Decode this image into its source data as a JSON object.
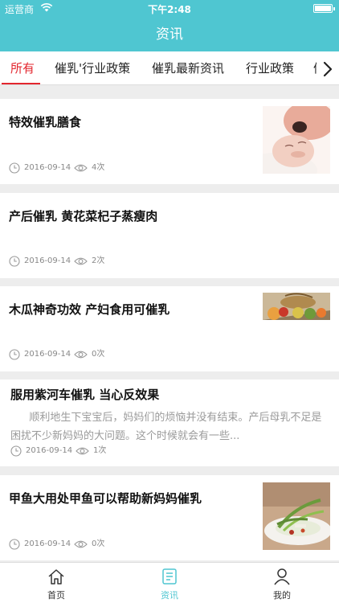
{
  "status_bar": {
    "carrier": "运营商",
    "time": "下午2:48"
  },
  "nav": {
    "title": "资讯"
  },
  "tabs": [
    {
      "label": "所有"
    },
    {
      "label": "催乳'行业政策"
    },
    {
      "label": "催乳最新资讯"
    },
    {
      "label": "行业政策"
    },
    {
      "label": "催乳"
    }
  ],
  "articles": [
    {
      "title": "特效催乳膳食",
      "date": "2016-09-14",
      "views": "4次"
    },
    {
      "title": "产后催乳 黄花菜杞子蒸瘦肉",
      "date": "2016-09-14",
      "views": "2次"
    },
    {
      "title": "木瓜神奇功效 产妇食用可催乳",
      "date": "2016-09-14",
      "views": "0次"
    },
    {
      "title": "服用紫河车催乳 当心反效果",
      "excerpt": "顺利地生下宝宝后，妈妈们的烦恼并没有结束。产后母乳不足是困扰不少新妈妈的大问题。这个时候就会有一些...",
      "date": "2016-09-14",
      "views": "1次"
    },
    {
      "title": "甲鱼大用处甲鱼可以帮助新妈妈催乳",
      "date": "2016-09-14",
      "views": "0次"
    }
  ],
  "tab_bar": [
    {
      "label": "首页",
      "icon": "home-icon"
    },
    {
      "label": "资讯",
      "icon": "news-icon"
    },
    {
      "label": "我的",
      "icon": "user-icon"
    }
  ],
  "colors": {
    "header": "#4fc6d1",
    "active_tab": "#e3262e",
    "meta_text": "#888888"
  }
}
